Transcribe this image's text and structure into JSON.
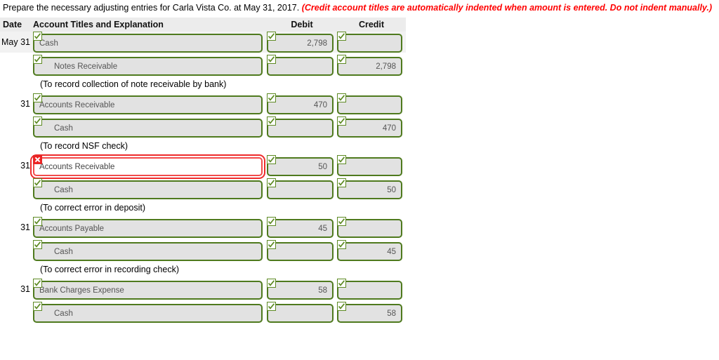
{
  "instruction": {
    "main": "Prepare the necessary adjusting entries for Carla Vista Co. at May 31, 2017.",
    "note": "(Credit account titles are automatically indented when amount is entered. Do not indent manually.)"
  },
  "colors": {
    "valid_border": "#4f7a1e",
    "error_border": "#ee2b2b",
    "field_bg": "#e2e2e2",
    "header_bg": "#ececec",
    "note_text": "#ff0000"
  },
  "table": {
    "headers": {
      "date": "Date",
      "account": "Account Titles and Explanation",
      "debit": "Debit",
      "credit": "Credit"
    },
    "rows": [
      {
        "date": "May 31",
        "account": "Cash",
        "indent": false,
        "debit": "2,798",
        "credit": "",
        "status": "valid",
        "shaded": true
      },
      {
        "date": "",
        "account": "Notes Receivable",
        "indent": true,
        "debit": "",
        "credit": "2,798",
        "status": "valid",
        "shaded": false
      },
      {
        "explanation": "(To record collection of note receivable by bank)"
      },
      {
        "date": "31",
        "account": "Accounts Receivable",
        "indent": false,
        "debit": "470",
        "credit": "",
        "status": "valid",
        "shaded": false
      },
      {
        "date": "",
        "account": "Cash",
        "indent": true,
        "debit": "",
        "credit": "470",
        "status": "valid",
        "shaded": false
      },
      {
        "explanation": "(To record NSF check)"
      },
      {
        "date": "31",
        "account": "Accounts Receivable",
        "indent": false,
        "debit": "50",
        "credit": "",
        "status": "error",
        "shaded": false
      },
      {
        "date": "",
        "account": "Cash",
        "indent": true,
        "debit": "",
        "credit": "50",
        "status": "valid",
        "shaded": false
      },
      {
        "explanation": "(To correct error in deposit)"
      },
      {
        "date": "31",
        "account": "Accounts Payable",
        "indent": false,
        "debit": "45",
        "credit": "",
        "status": "valid",
        "shaded": false
      },
      {
        "date": "",
        "account": "Cash",
        "indent": true,
        "debit": "",
        "credit": "45",
        "status": "valid",
        "shaded": false
      },
      {
        "explanation": "(To correct error in recording check)"
      },
      {
        "date": "31",
        "account": "Bank Charges Expense",
        "indent": false,
        "debit": "58",
        "credit": "",
        "status": "valid",
        "shaded": false
      },
      {
        "date": "",
        "account": "Cash",
        "indent": true,
        "debit": "",
        "credit": "58",
        "status": "valid",
        "shaded": false
      }
    ]
  },
  "icons": {
    "valid_badge": "check-icon",
    "error_badge": "x-icon"
  }
}
